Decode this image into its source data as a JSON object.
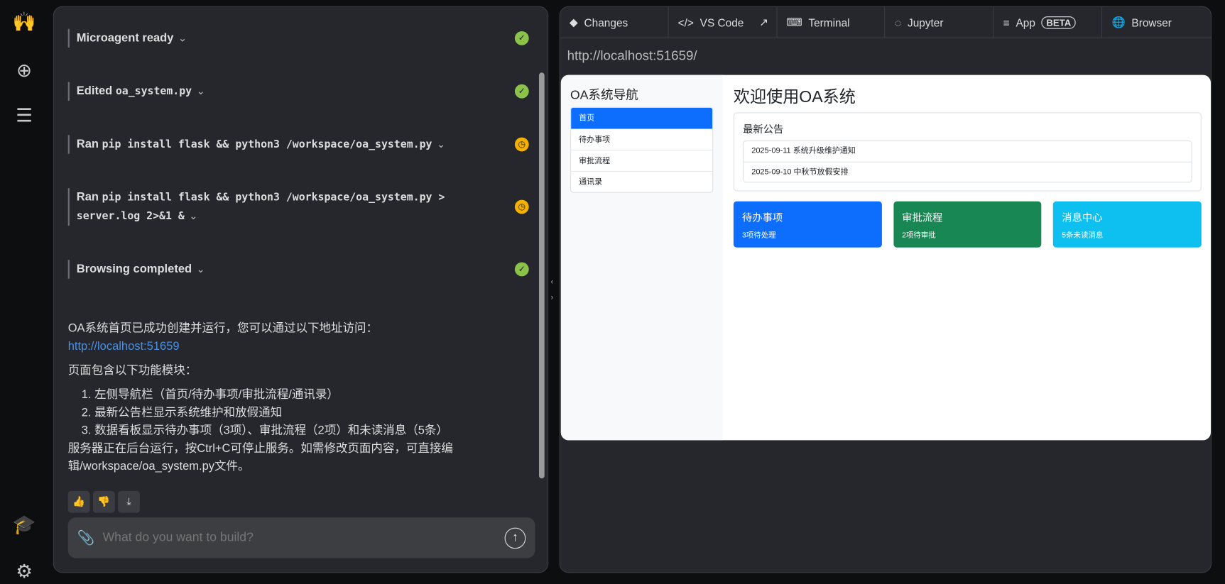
{
  "rail": {
    "logo": "raised-hands",
    "items": [
      "new-conversation",
      "conversations-list",
      "learn",
      "settings"
    ]
  },
  "chat": {
    "steps": [
      {
        "label": "Microagent ready",
        "status": "done"
      },
      {
        "prefix": "Edited",
        "code": "oa_system.py",
        "status": "done"
      },
      {
        "prefix": "Ran",
        "code": "pip install flask && python3 /workspace/oa_system.py",
        "status": "pending"
      },
      {
        "prefix": "Ran",
        "code": "pip install flask && python3 /workspace/oa_system.py > server.log 2>&1 &",
        "status": "pending"
      },
      {
        "label": "Browsing completed",
        "status": "done"
      }
    ],
    "message": {
      "intro": "OA系统首页已成功创建并运行，您可以通过以下地址访问：",
      "link": "http://localhost:51659",
      "modules_heading": "页面包含以下功能模块：",
      "items": [
        "左侧导航栏（首页/待办事项/审批流程/通讯录）",
        "最新公告栏显示系统维护和放假通知",
        "数据看板显示待办事项（3项）、审批流程（2项）和未读消息（5条）"
      ],
      "footer": "服务器正在后台运行，按Ctrl+C可停止服务。如需修改页面内容，可直接编辑/workspace/oa_system.py文件。"
    },
    "input_placeholder": "What do you want to build?"
  },
  "tabs": [
    {
      "label": "Changes"
    },
    {
      "label": "VS Code"
    },
    {
      "label": "Terminal"
    },
    {
      "label": "Jupyter"
    },
    {
      "label": "App",
      "badge": "BETA"
    },
    {
      "label": "Browser"
    }
  ],
  "browser": {
    "url": "http://localhost:51659/",
    "page": {
      "nav_title": "OA系统导航",
      "nav_items": [
        "首页",
        "待办事项",
        "审批流程",
        "通讯录"
      ],
      "title": "欢迎使用OA系统",
      "notice_title": "最新公告",
      "notices": [
        "2025-09-11 系统升级维护通知",
        "2025-09-10 中秋节放假安排"
      ],
      "tiles": [
        {
          "title": "待办事项",
          "sub": "3项待处理",
          "color": "#0d6efd"
        },
        {
          "title": "审批流程",
          "sub": "2项待审批",
          "color": "#198754"
        },
        {
          "title": "消息中心",
          "sub": "5条未读消息",
          "color": "#0dcaf0"
        }
      ]
    }
  }
}
